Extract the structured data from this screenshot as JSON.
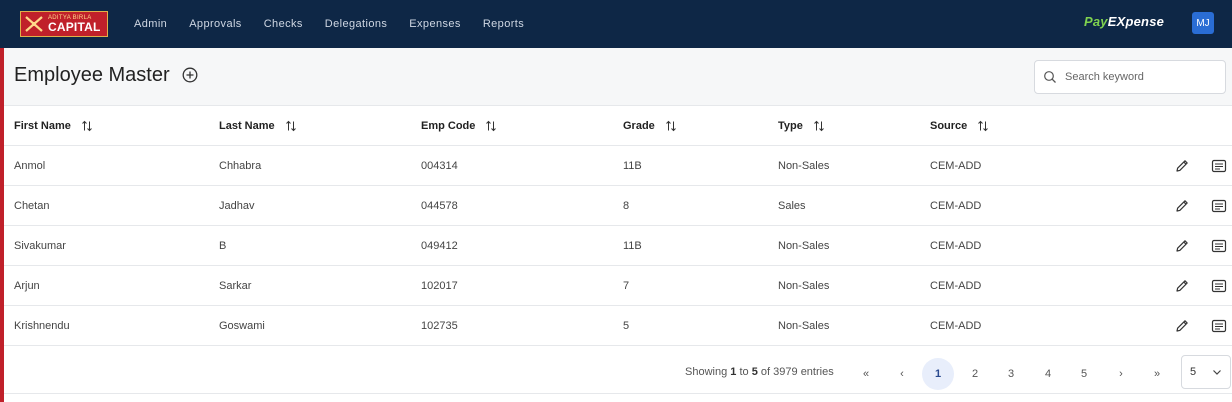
{
  "colors": {
    "nav_bg": "#0e2746",
    "brand_green": "#7fd14f",
    "accent_blue": "#2a6dd4",
    "logo_red": "#c0202a"
  },
  "logo": {
    "line1": "ADITYA BIRLA",
    "line2": "CAPITAL"
  },
  "nav": {
    "items": [
      "Admin",
      "Approvals",
      "Checks",
      "Delegations",
      "Expenses",
      "Reports"
    ]
  },
  "brand": {
    "pay": "Pay",
    "expense": "EXpense"
  },
  "user": {
    "initials": "MJ"
  },
  "page": {
    "title": "Employee Master"
  },
  "search": {
    "placeholder": "Search keyword",
    "value": ""
  },
  "table": {
    "columns": [
      "First Name",
      "Last Name",
      "Emp Code",
      "Grade",
      "Type",
      "Source"
    ],
    "rows": [
      [
        "Anmol",
        "Chhabra",
        "004314",
        "11B",
        "Non-Sales",
        "CEM-ADD"
      ],
      [
        "Chetan",
        "Jadhav",
        "044578",
        "8",
        "Sales",
        "CEM-ADD"
      ],
      [
        "Sivakumar",
        "B",
        "049412",
        "11B",
        "Non-Sales",
        "CEM-ADD"
      ],
      [
        "Arjun",
        "Sarkar",
        "102017",
        "7",
        "Non-Sales",
        "CEM-ADD"
      ],
      [
        "Krishnendu",
        "Goswami",
        "102735",
        "5",
        "Non-Sales",
        "CEM-ADD"
      ]
    ]
  },
  "pagination": {
    "showing_prefix": "Showing",
    "from": "1",
    "to_word": "to",
    "to": "5",
    "of_word": "of",
    "total": "3979",
    "entries_word": "entries",
    "first": "«",
    "prev": "‹",
    "pages": [
      "1",
      "2",
      "3",
      "4",
      "5"
    ],
    "active_page": "1",
    "next": "›",
    "last": "»",
    "page_size": "5"
  },
  "icons": {
    "add": "plus-circle-icon",
    "search": "search-icon",
    "sort": "sort-arrows-icon",
    "edit": "pencil-icon",
    "note": "note-icon",
    "page_size_chevron": "chevron-down-icon"
  }
}
